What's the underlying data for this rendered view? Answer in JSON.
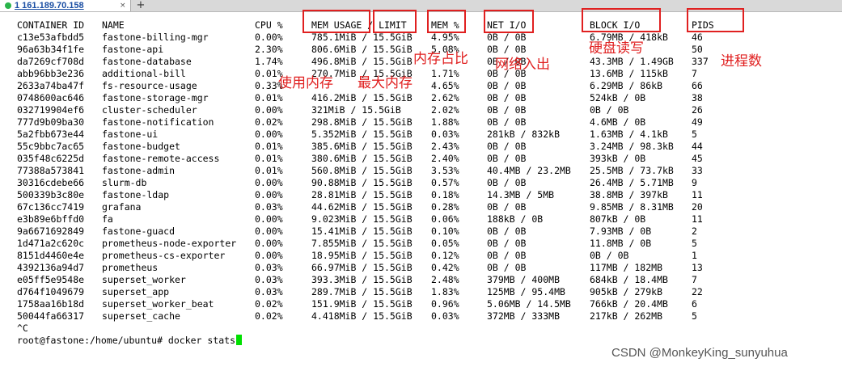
{
  "tab": {
    "label": "1 161.189.70.158",
    "close": "×",
    "add": "+"
  },
  "header": {
    "id": "CONTAINER ID",
    "name": "NAME",
    "cpu": "CPU %",
    "mem_usage": "MEM USAGE / LIMIT",
    "mem_pct": "MEM %",
    "net": "NET I/O",
    "block": "BLOCK I/O",
    "pids": "PIDS"
  },
  "rows": [
    [
      "c13e53afbdd5",
      "fastone-billing-mgr",
      "0.00%",
      "785.1MiB / 15.5GiB",
      "4.95%",
      "0B / 0B",
      "6.79MB / 418kB",
      "46"
    ],
    [
      "96a63b34f1fe",
      "fastone-api",
      "2.30%",
      "806.6MiB / 15.5GiB",
      "5.08%",
      "0B / 0B",
      "",
      "50"
    ],
    [
      "da7269cf708d",
      "fastone-database",
      "1.74%",
      "496.8MiB / 15.5GiB",
      "",
      "0B / 0B",
      "43.3MB / 1.49GB",
      "337"
    ],
    [
      "abb96bb3e236",
      "additional-bill",
      "0.01%",
      "270.7MiB / 15.5GiB",
      "1.71%",
      "0B / 0B",
      "13.6MB / 115kB",
      "7"
    ],
    [
      "2633a74ba47f",
      "fs-resource-usage",
      "0.33%",
      "",
      "4.65%",
      "0B / 0B",
      "6.29MB / 86kB",
      "66"
    ],
    [
      "0748600ac646",
      "fastone-storage-mgr",
      "0.01%",
      "416.2MiB / 15.5GiB",
      "2.62%",
      "0B / 0B",
      "524kB / 0B",
      "38"
    ],
    [
      "032719904ef6",
      "cluster-scheduler",
      "0.00%",
      "321MiB / 15.5GiB",
      "2.02%",
      "0B / 0B",
      "0B / 0B",
      "26"
    ],
    [
      "777d9b09ba30",
      "fastone-notification",
      "0.02%",
      "298.8MiB / 15.5GiB",
      "1.88%",
      "0B / 0B",
      "4.6MB / 0B",
      "49"
    ],
    [
      "5a2fbb673e44",
      "fastone-ui",
      "0.00%",
      "5.352MiB / 15.5GiB",
      "0.03%",
      "281kB / 832kB",
      "1.63MB / 4.1kB",
      "5"
    ],
    [
      "55c9bbc7ac65",
      "fastone-budget",
      "0.01%",
      "385.6MiB / 15.5GiB",
      "2.43%",
      "0B / 0B",
      "3.24MB / 98.3kB",
      "44"
    ],
    [
      "035f48c6225d",
      "fastone-remote-access",
      "0.01%",
      "380.6MiB / 15.5GiB",
      "2.40%",
      "0B / 0B",
      "393kB / 0B",
      "45"
    ],
    [
      "77388a573841",
      "fastone-admin",
      "0.01%",
      "560.8MiB / 15.5GiB",
      "3.53%",
      "40.4MB / 23.2MB",
      "25.5MB / 73.7kB",
      "33"
    ],
    [
      "30316cdebe66",
      "slurm-db",
      "0.00%",
      "90.88MiB / 15.5GiB",
      "0.57%",
      "0B / 0B",
      "26.4MB / 5.71MB",
      "9"
    ],
    [
      "500339b3c80e",
      "fastone-ldap",
      "0.00%",
      "28.81MiB / 15.5GiB",
      "0.18%",
      "14.3MB / 5MB",
      "38.8MB / 397kB",
      "11"
    ],
    [
      "67c136cc7419",
      "grafana",
      "0.03%",
      "44.62MiB / 15.5GiB",
      "0.28%",
      "0B / 0B",
      "9.85MB / 8.31MB",
      "20"
    ],
    [
      "e3b89e6bffd0",
      "fa",
      "0.00%",
      "9.023MiB / 15.5GiB",
      "0.06%",
      "188kB / 0B",
      "807kB / 0B",
      "11"
    ],
    [
      "9a6671692849",
      "fastone-guacd",
      "0.00%",
      "15.41MiB / 15.5GiB",
      "0.10%",
      "0B / 0B",
      "7.93MB / 0B",
      "2"
    ],
    [
      "1d471a2c620c",
      "prometheus-node-exporter",
      "0.00%",
      "7.855MiB / 15.5GiB",
      "0.05%",
      "0B / 0B",
      "11.8MB / 0B",
      "5"
    ],
    [
      "8151d4460e4e",
      "prometheus-cs-exporter",
      "0.00%",
      "18.95MiB / 15.5GiB",
      "0.12%",
      "0B / 0B",
      "0B / 0B",
      "1"
    ],
    [
      "4392136a94d7",
      "prometheus",
      "0.03%",
      "66.97MiB / 15.5GiB",
      "0.42%",
      "0B / 0B",
      "117MB / 182MB",
      "13"
    ],
    [
      "e05ff5e9548e",
      "superset_worker",
      "0.03%",
      "393.3MiB / 15.5GiB",
      "2.48%",
      "379MB / 400MB",
      "684kB / 18.4MB",
      "7"
    ],
    [
      "d764f1049679",
      "superset_app",
      "0.03%",
      "289.7MiB / 15.5GiB",
      "1.83%",
      "125MB / 95.4MB",
      "905kB / 279kB",
      "22"
    ],
    [
      "1758aa16b18d",
      "superset_worker_beat",
      "0.02%",
      "151.9MiB / 15.5GiB",
      "0.96%",
      "5.06MB / 14.5MB",
      "766kB / 20.4MB",
      "6"
    ],
    [
      "50044fa66317",
      "superset_cache",
      "0.02%",
      "4.418MiB / 15.5GiB",
      "0.03%",
      "372MB / 333MB",
      "217kB / 262MB",
      "5"
    ]
  ],
  "interrupt": "^C",
  "prompt": "root@fastone:/home/ubuntu# docker stats",
  "annotations": {
    "mem_pct_note": "内存占比",
    "net_note": "网络入出",
    "block_note": "硬盘读写",
    "pids_note": "进程数",
    "mem_usage_note": "使用内存",
    "limit_note": "最大内存"
  },
  "watermark": "CSDN @MonkeyKing_sunyuhua",
  "colors": {
    "annotation": "#e02020",
    "cursor": "#00e000",
    "tab_text": "#1a4ea3"
  }
}
